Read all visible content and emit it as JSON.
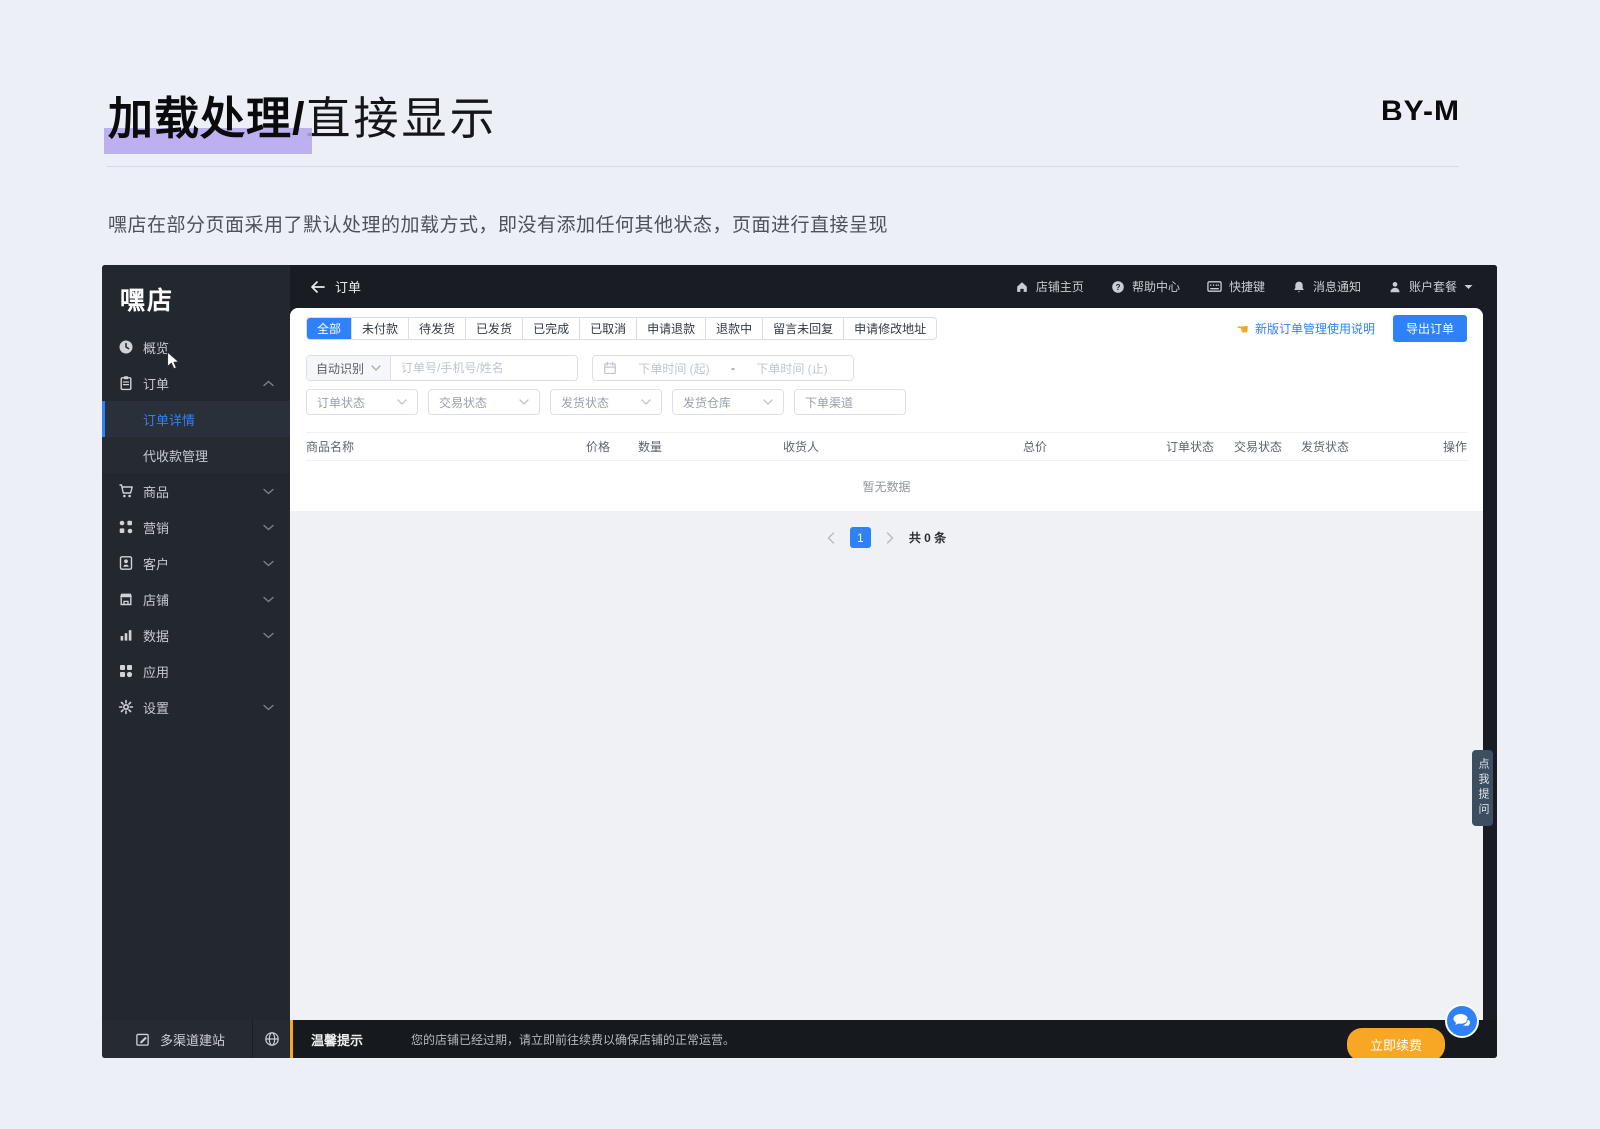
{
  "page": {
    "title_bold": "加载处理/",
    "title_light": "直接显示",
    "watermark": "BY-M",
    "description": "嘿店在部分页面采用了默认处理的加载方式，即没有添加任何其他状态，页面进行直接呈现",
    "colors": {
      "accent": "#2f81f7",
      "warning": "#f7a723",
      "title_highlight": "#b4a5ef"
    }
  },
  "admin": {
    "topbar": {
      "back_label": "订单",
      "links": [
        "店铺主页",
        "帮助中心",
        "快捷键",
        "消息通知",
        "账户套餐"
      ]
    },
    "sidebar": {
      "logo": "嘿店",
      "items": [
        "概览",
        "订单",
        "商品",
        "营销",
        "客户",
        "店铺",
        "数据",
        "应用",
        "设置"
      ],
      "submenu": [
        "订单详情",
        "代收款管理"
      ],
      "footer_build": "多渠道建站"
    },
    "tabs": [
      "全部",
      "未付款",
      "待发货",
      "已发货",
      "已完成",
      "已取消",
      "申请退款",
      "退款中",
      "留言未回复",
      "申请修改地址"
    ],
    "toolbar": {
      "help_link": "新版订单管理使用说明",
      "export_label": "导出订单"
    },
    "filters": {
      "auto_detect": "自动识别",
      "search_placeholder": "订单号/手机号/姓名",
      "date_start": "下单时间 (起)",
      "date_sep": "-",
      "date_end": "下单时间 (止)",
      "selects": [
        "订单状态",
        "交易状态",
        "发货状态",
        "发货仓库",
        "下单渠道"
      ]
    },
    "table": {
      "headers": [
        "商品名称",
        "价格",
        "数量",
        "收货人",
        "总价",
        "订单状态",
        "交易状态",
        "发货状态",
        "操作"
      ],
      "empty_text": "暂无数据"
    },
    "pagination": {
      "page": "1",
      "total_text": "共 0 条"
    },
    "notice": {
      "title": "温馨提示",
      "message": "您的店铺已经过期，请立即前往续费以确保店铺的正常运营。",
      "renew_label": "立即续费"
    },
    "floating_tab": "点我提问"
  }
}
